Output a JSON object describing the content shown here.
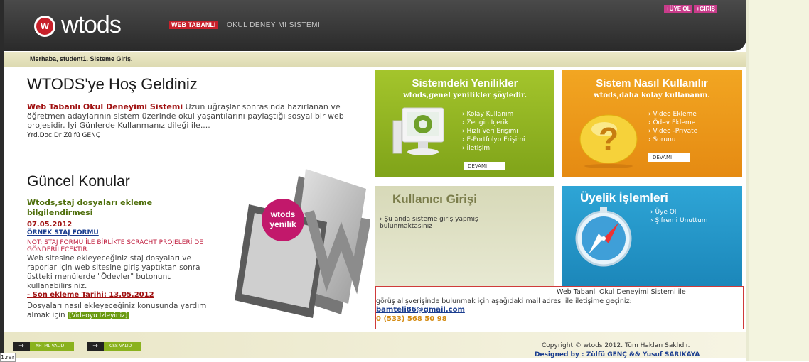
{
  "header": {
    "logo_letter": "w",
    "logo_text": "wtods",
    "tagline_red": "WEB TABANLI",
    "tagline_rest": "OKUL DENEYİMİ SİSTEMİ",
    "links": [
      "+ÜYE OL",
      "+GİRİŞ"
    ]
  },
  "welcome": "Merhaba, student1. Sisteme Giriş.",
  "intro": {
    "title": "WTODS'ye Hoş Geldiniz",
    "bold": "Web Tabanlı Okul Deneyimi Sistemi",
    "body": " Uzun uğraşlar sonrasında hazırlanan ve öğretmen adaylarının sistem üzerinde okul yaşantılarını paylaştığı sosyal bir web projesidir. İyi Günlerde Kullanmanız dileği ile....",
    "author": "Yrd.Doc.Dr Zülfü GENÇ"
  },
  "news": {
    "title": "Güncel Konular",
    "item_title": "Wtods,staj dosyaları ekleme bilgilendirmesi",
    "date": "07.05.2012",
    "link": "ÖRNEK STAJ FORMU",
    "note": "NOT: STAJ FORMU İLE BİRLİKTE SCRACHT PROJELERİ DE GÖNDERİLECEKTİR.",
    "body": "Web sitesine ekleyeceğiniz staj dosyaları ve raporlar için web sitesine giriş yaptıktan sonra üstteki menülerde \"Ödevler\" butonunu kullanabilirsiniz.",
    "deadline": "- Son ekleme Tarihi: 13.05.2012",
    "body2": " Dosyaları nasıl ekleyeceğiniz konusunda yardım almak için ",
    "video_link": "[Videoyu İzleyiniz]",
    "badge_line1": "wtods",
    "badge_line2": "yenilik"
  },
  "boxes": {
    "new": {
      "title": "Sistemdeki Yenilikler",
      "subtitle": "wtods,genel yenilikler şöyledir.",
      "items": [
        "Kolay Kullanım",
        "Zengin İçerik",
        "Hızlı Veri Erişimi",
        "E-Portfolyo Erişimi",
        "İletişim"
      ],
      "more": "DEVAMI"
    },
    "howto": {
      "title": "Sistem Nasıl Kullanılır",
      "subtitle": "wtods,daha kolay kullananın.",
      "items": [
        "Video Ekleme",
        "Ödev Ekleme",
        "Video -Private",
        "Sorunu"
      ],
      "more": "DEVAMI"
    },
    "login": {
      "title": "Kullanıcı Girişi",
      "text": "› Şu anda sisteme giriş yapmış bulunmaktasınız"
    },
    "membership": {
      "title": "Üyelik İşlemleri",
      "items": [
        "Üye Ol",
        "Şifremi Unuttum"
      ]
    }
  },
  "contact": {
    "line1": "Web Tabanlı Okul Deneyimi Sistemi ile",
    "line2": "görüş alışverişinde bulunmak için aşağıdaki mail adresi ile iletişime geçiniz:",
    "email": "bamteli86@gmail.com",
    "phone": "0 (533) 568 50 98"
  },
  "footer": {
    "badges": [
      "XHTML VALID",
      "CSS VALID"
    ],
    "arrow": "→",
    "copyright": "Copyright © wtods 2012. Tüm Hakları Saklıdır.",
    "designed": "Designed by : Zülfü GENÇ && Yusuf SARIKAYA",
    "rar": "1.rar"
  }
}
